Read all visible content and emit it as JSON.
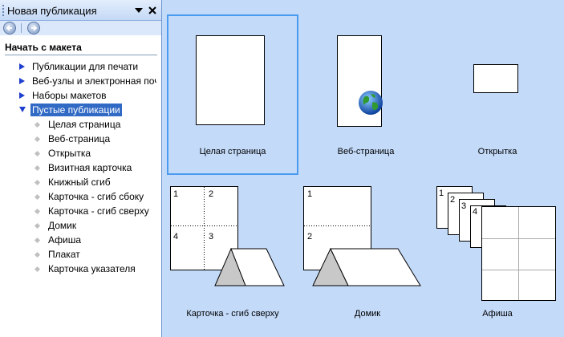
{
  "pane": {
    "title": "Новая публикация",
    "section_title": "Начать с макета",
    "categories": [
      {
        "label": "Публикации для печати"
      },
      {
        "label": "Веб-узлы и электронная почта"
      },
      {
        "label": "Наборы макетов"
      },
      {
        "label": "Пустые публикации"
      }
    ],
    "blank_items": [
      {
        "label": "Целая страница"
      },
      {
        "label": "Веб-страница"
      },
      {
        "label": "Открытка"
      },
      {
        "label": "Визитная карточка"
      },
      {
        "label": "Книжный сгиб"
      },
      {
        "label": "Карточка - сгиб сбоку"
      },
      {
        "label": "Карточка - сгиб сверху"
      },
      {
        "label": "Домик"
      },
      {
        "label": "Афиша"
      },
      {
        "label": "Плакат"
      },
      {
        "label": "Карточка указателя"
      }
    ]
  },
  "gallery": {
    "tiles": [
      {
        "caption": "Целая страница"
      },
      {
        "caption": "Веб-страница"
      },
      {
        "caption": "Открытка"
      },
      {
        "caption": "Карточка - сгиб сверху",
        "numbers": [
          "1",
          "2",
          "4",
          "3"
        ]
      },
      {
        "caption": "Домик",
        "numbers": [
          "1",
          "2"
        ]
      },
      {
        "caption": "Афиша",
        "numbers": [
          "1",
          "2",
          "3",
          "4"
        ]
      }
    ]
  },
  "colors": {
    "gallery_bg": "#c3daf9",
    "selection_border": "#4a9bf0",
    "tree_selected_bg": "#316ac5",
    "tree_arrow": "#1f3fcf"
  },
  "icons": {
    "pane_menu": "triangle-down-icon",
    "pane_close": "close-icon",
    "back": "back-arrow-icon",
    "forward": "forward-arrow-icon",
    "web": "globe-icon"
  }
}
